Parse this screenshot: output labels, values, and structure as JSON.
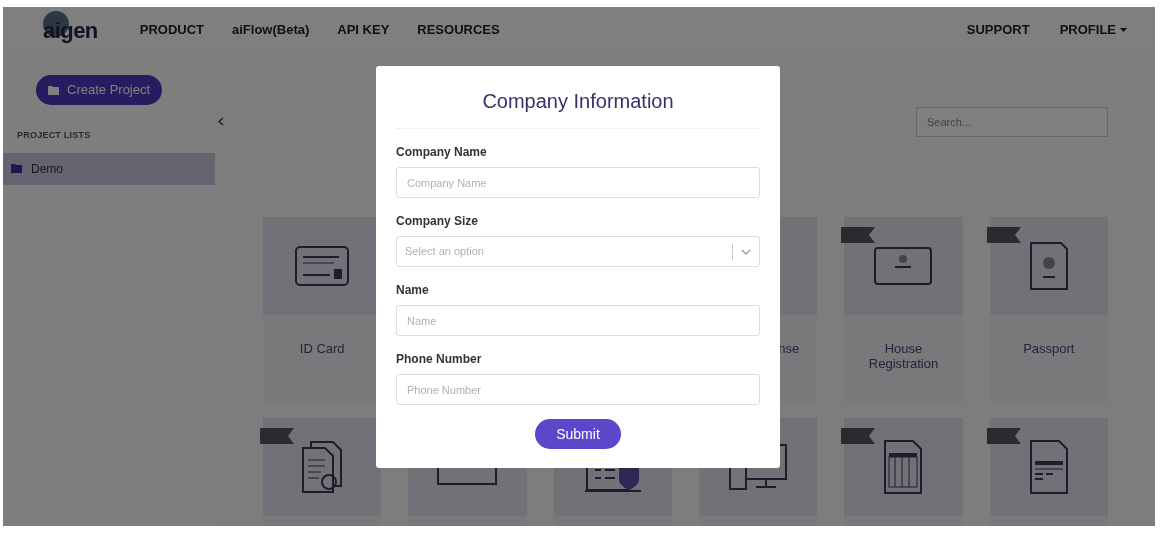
{
  "nav": {
    "logo": "aigen",
    "items": [
      "PRODUCT",
      "aiFlow(Beta)",
      "API KEY",
      "RESOURCES"
    ],
    "right": [
      {
        "label": "SUPPORT",
        "kind": "link"
      },
      {
        "label": "PROFILE",
        "kind": "dropdown"
      }
    ]
  },
  "sidebar": {
    "button": "Create Project",
    "section": "PROJECT LISTS",
    "projects": [
      {
        "label": "Demo",
        "selected": true
      }
    ]
  },
  "search": {
    "placeholder": "Search..."
  },
  "cards": [
    {
      "label": "ID Card",
      "kind": "full",
      "badge": false
    },
    {
      "label": "nse",
      "kind": "cut"
    },
    {
      "label": "House Registration",
      "kind": "full",
      "badge": true
    },
    {
      "label": "Passport",
      "kind": "full",
      "badge": true
    },
    {
      "kind": "full",
      "badge": true
    },
    {
      "kind": "full"
    },
    {
      "kind": "full"
    },
    {
      "kind": "full"
    },
    {
      "kind": "full",
      "badge": true
    },
    {
      "kind": "full",
      "badge": true
    }
  ],
  "modal": {
    "title": "Company Information",
    "fields": [
      {
        "label": "Company Name",
        "kind": "text",
        "placeholder": "Company Name"
      },
      {
        "label": "Company Size",
        "kind": "select",
        "placeholder": "Select an option"
      },
      {
        "label": "Name",
        "kind": "text",
        "placeholder": "Name"
      },
      {
        "label": "Phone Number",
        "kind": "text",
        "placeholder": "Phone Number"
      }
    ],
    "submit": "Submit"
  }
}
